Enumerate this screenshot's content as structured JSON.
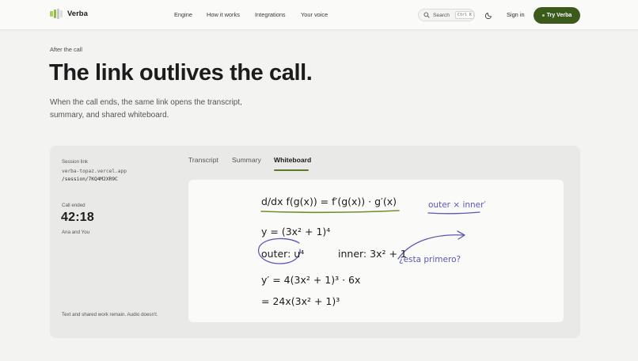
{
  "brand": {
    "name": "Verba"
  },
  "nav": {
    "items": [
      "Engine",
      "How it works",
      "Integrations",
      "Your voice"
    ]
  },
  "search": {
    "label": "Search",
    "shortcut": "Ctrl K"
  },
  "header": {
    "signin": "Sign in",
    "cta": "Try Verba"
  },
  "hero": {
    "eyebrow": "After the call",
    "title": "The link outlives the call.",
    "subtitle": "When the call ends, the same link opens the transcript, summary, and shared whiteboard."
  },
  "session": {
    "label": "Session link",
    "link_line1": "verba-topaz.vercel.app",
    "link_line2": "/session/7KQ4M2XR9C",
    "status_label": "Call ended",
    "duration": "42:18",
    "participants": "Ana and You",
    "note": "Text and shared work remain. Audio doesn't."
  },
  "tabs": [
    "Transcript",
    "Summary",
    "Whiteboard"
  ],
  "active_tab": "Whiteboard",
  "whiteboard": {
    "line1": "d/dx f(g(x)) = f′(g(x)) · g′(x)",
    "line2": "y = (3x² + 1)⁴",
    "line3a": "outer: u⁴",
    "line3b": "inner: 3x² + 1",
    "line4": "y′ = 4(3x² + 1)³ · 6x",
    "line5": "= 24x(3x² + 1)³",
    "annotation1": "outer × inner′",
    "annotation2": "¿esta primero?"
  },
  "colors": {
    "accent": "#3c5a1c",
    "ink": "#5b57b5",
    "highlight": "#6e8f2e"
  }
}
